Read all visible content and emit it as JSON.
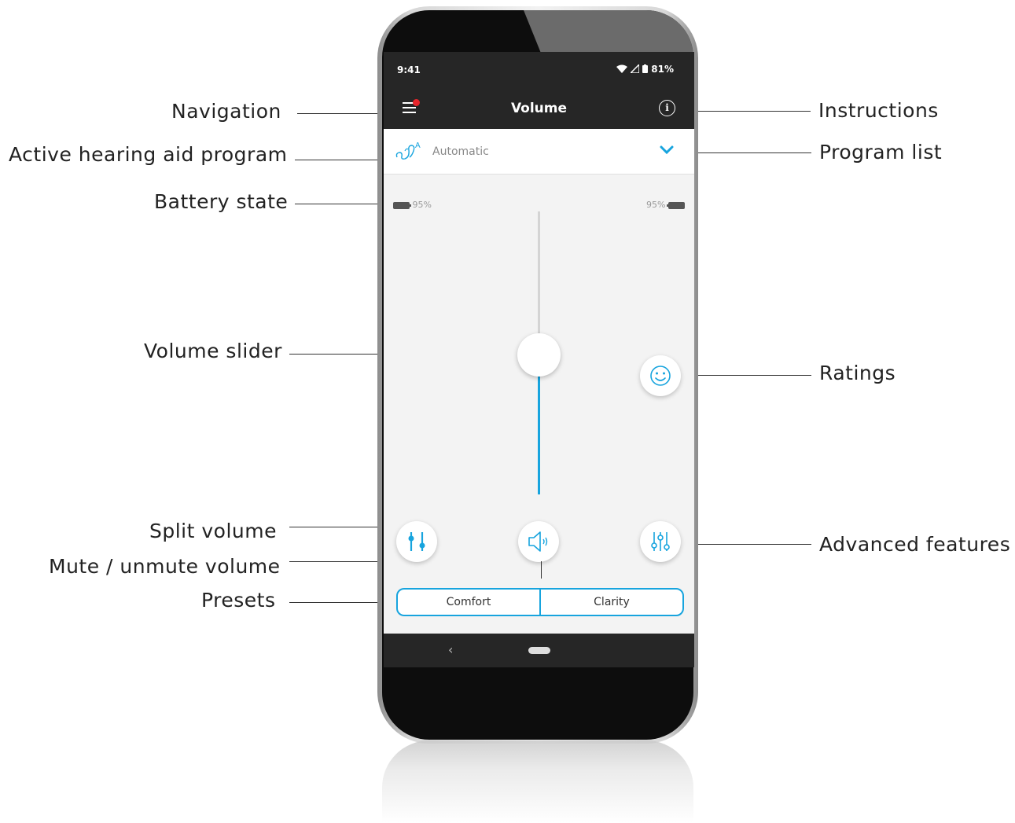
{
  "callouts": {
    "navigation": "Navigation",
    "active_program": "Active hearing aid program",
    "battery_state": "Battery state",
    "volume_slider": "Volume slider",
    "split_volume": "Split volume",
    "mute_unmute": "Mute / unmute volume",
    "presets": "Presets",
    "instructions": "Instructions",
    "program_list": "Program list",
    "ratings": "Ratings",
    "advanced_features": "Advanced features"
  },
  "status_bar": {
    "time": "9:41",
    "battery": "81%",
    "icons": [
      "wifi-icon",
      "cell-signal-icon",
      "battery-icon"
    ]
  },
  "app_bar": {
    "title": "Volume",
    "menu_icon": "hamburger-menu-icon",
    "notification_dot_color": "#e8262c",
    "info_icon": "info-icon"
  },
  "program": {
    "name": "Automatic",
    "icon": "hearing-aid-automatic-icon",
    "dropdown_icon": "chevron-down-icon"
  },
  "battery": {
    "left": "95%",
    "right": "95%"
  },
  "volume": {
    "level": 0.55,
    "accent_color": "#17a4de"
  },
  "buttons": {
    "ratings_icon": "smiley-icon",
    "split_volume_icon": "split-sliders-icon",
    "mute_icon": "speaker-icon",
    "advanced_icon": "equalizer-icon"
  },
  "presets": [
    "Comfort",
    "Clarity"
  ],
  "nav": {
    "back_icon": "back-chevron-icon",
    "home_icon": "home-pill-icon"
  }
}
